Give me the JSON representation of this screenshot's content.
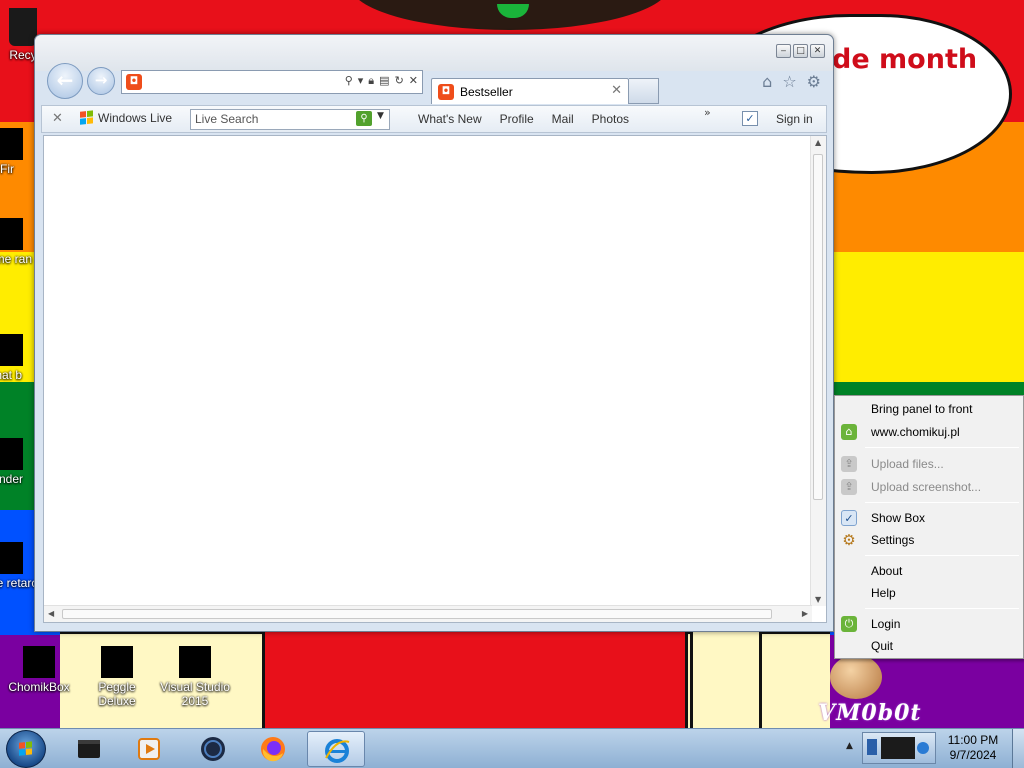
{
  "desktop": {
    "bubble_line1": "de month",
    "bubble_line2": "!",
    "watermark": "VM0b0t",
    "icons": [
      {
        "label": "Recy"
      },
      {
        "label": "Fir"
      },
      {
        "label": "some ran"
      },
      {
        "label": "that b"
      },
      {
        "label": "Ender"
      },
      {
        "label": "none retarc"
      },
      {
        "label": "ChomikBox"
      },
      {
        "label": "Peggle Deluxe"
      },
      {
        "label": "Visual Studio 2015"
      }
    ]
  },
  "ie": {
    "address_url": "",
    "tab_title": "Bestseller",
    "toolbar": {
      "windows_live": "Windows Live",
      "search_placeholder": "Live Search",
      "links": [
        "What's New",
        "Profile",
        "Mail",
        "Photos"
      ],
      "sign_in": "Sign in"
    }
  },
  "tray_menu": {
    "items": [
      {
        "label": "Bring panel to front",
        "enabled": true,
        "icon": ""
      },
      {
        "label": "www.chomikuj.pl",
        "enabled": true,
        "icon": "home-icon"
      },
      {
        "label": "Upload files...",
        "enabled": false,
        "icon": "upload-files-icon"
      },
      {
        "label": "Upload screenshot...",
        "enabled": false,
        "icon": "upload-screenshot-icon"
      },
      {
        "label": "Show Box",
        "enabled": true,
        "icon": "check-icon"
      },
      {
        "label": "Settings",
        "enabled": true,
        "icon": "gear-icon"
      },
      {
        "label": "About",
        "enabled": true,
        "icon": ""
      },
      {
        "label": "Help",
        "enabled": true,
        "icon": ""
      },
      {
        "label": "Login",
        "enabled": true,
        "icon": "login-icon"
      },
      {
        "label": "Quit",
        "enabled": true,
        "icon": ""
      }
    ]
  },
  "taskbar": {
    "items": [
      {
        "name": "start-button"
      },
      {
        "name": "terminal-app-icon"
      },
      {
        "name": "media-player-icon"
      },
      {
        "name": "dark-globe-icon"
      },
      {
        "name": "firefox-icon"
      },
      {
        "name": "internet-explorer-icon",
        "active": true
      }
    ],
    "clock_time": "11:00 PM",
    "clock_date": "9/7/2024"
  },
  "colors": {
    "flag_red": "#e8101a",
    "flag_orange": "#fe8a00",
    "flag_yellow": "#ffed00",
    "flag_green": "#008227",
    "flag_blue": "#0051ff",
    "flag_purple": "#7a00a0",
    "bubble_text": "#cf0d1a"
  }
}
